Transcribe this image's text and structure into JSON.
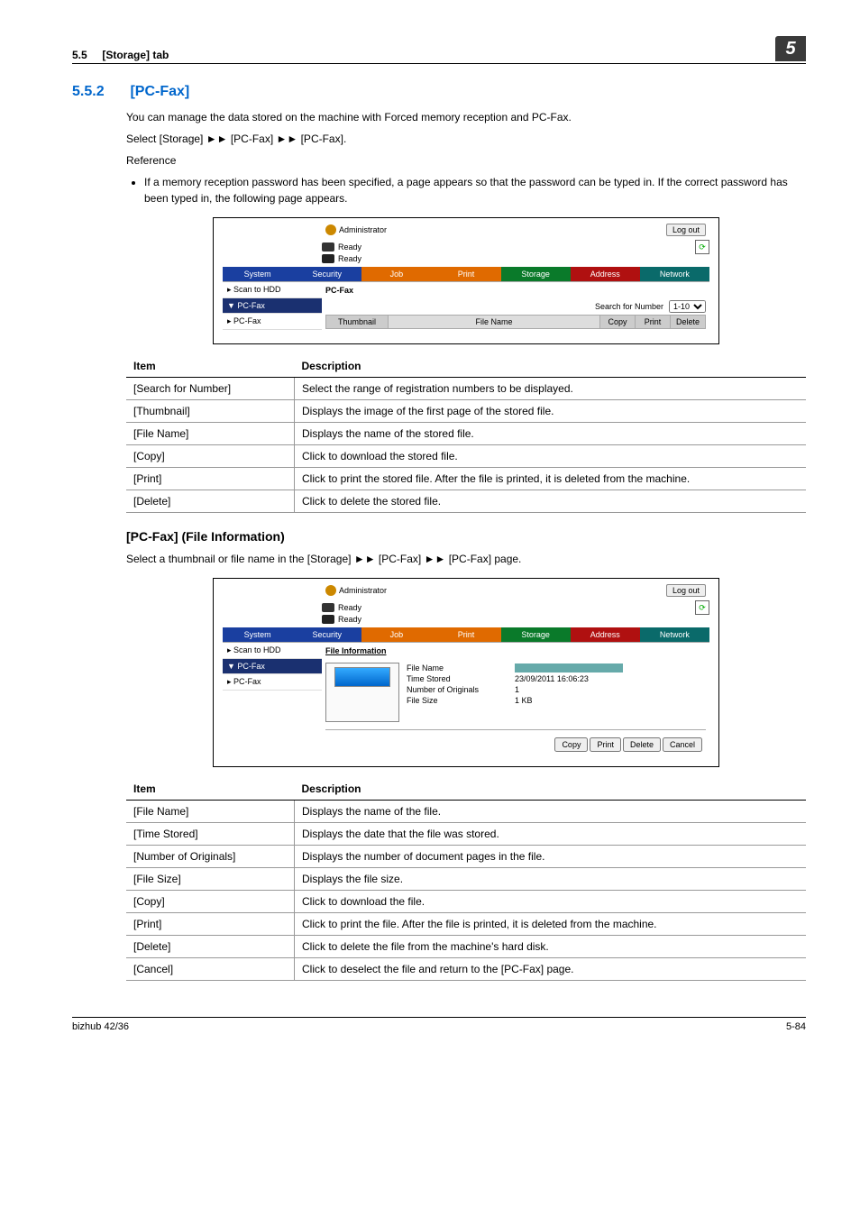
{
  "header": {
    "section": "5.5",
    "tab_label": "[Storage] tab",
    "chapter": "5"
  },
  "sec": {
    "num": "5.5.2",
    "title": "[PC-Fax]",
    "p1": "You can manage the data stored on the machine with Forced memory reception and PC-Fax.",
    "p2_a": "Select [Storage] ",
    "p2_arrow": "►►",
    "p2_b": " [PC-Fax] ",
    "p2_c": " [PC-Fax].",
    "ref_label": "Reference",
    "ref_b1": "If a memory reception password has been specified, a page appears so that the password can be typed in. If the correct password has been typed in, the following page appears."
  },
  "shot1": {
    "admin": "Administrator",
    "logout": "Log out",
    "ready": "Ready",
    "tabs": [
      "System",
      "Security",
      "Job",
      "Print",
      "Storage",
      "Address",
      "Network"
    ],
    "side": {
      "scan": "▸ Scan to HDD",
      "pcfax_h": "▼ PC-Fax",
      "pcfax": "▸ PC-Fax"
    },
    "main_title": "PC-Fax",
    "search_label": "Search for Number",
    "search_opt": "1-10",
    "cols": {
      "tn": "Thumbnail",
      "fn": "File Name",
      "c": "Copy",
      "p": "Print",
      "d": "Delete"
    }
  },
  "table1": {
    "h_item": "Item",
    "h_desc": "Description",
    "rows": [
      {
        "i": "[Search for Number]",
        "d": "Select the range of registration numbers to be displayed."
      },
      {
        "i": "[Thumbnail]",
        "d": "Displays the image of the first page of the stored file."
      },
      {
        "i": "[File Name]",
        "d": "Displays the name of the stored file."
      },
      {
        "i": "[Copy]",
        "d": "Click to download the stored file."
      },
      {
        "i": "[Print]",
        "d": "Click to print the stored file. After the file is printed, it is deleted from the machine."
      },
      {
        "i": "[Delete]",
        "d": "Click to delete the stored file."
      }
    ]
  },
  "sub2": {
    "title": "[PC-Fax] (File Information)",
    "p_a": "Select a thumbnail or file name in the [Storage] ",
    "arrow": "►►",
    "p_b": " [PC-Fax] ",
    "p_c": " [PC-Fax] page."
  },
  "shot2": {
    "admin": "Administrator",
    "logout": "Log out",
    "ready": "Ready",
    "tabs": [
      "System",
      "Security",
      "Job",
      "Print",
      "Storage",
      "Address",
      "Network"
    ],
    "side": {
      "scan": "▸ Scan to HDD",
      "pcfax_h": "▼ PC-Fax",
      "pcfax": "▸ PC-Fax"
    },
    "main_title": "File Information",
    "kv": {
      "fn_k": "File Name",
      "fn_v": "",
      "ts_k": "Time Stored",
      "ts_v": "23/09/2011 16:06:23",
      "no_k": "Number of Originals",
      "no_v": "1",
      "fs_k": "File Size",
      "fs_v": "1 KB"
    },
    "btns": {
      "copy": "Copy",
      "print": "Print",
      "delete": "Delete",
      "cancel": "Cancel"
    }
  },
  "table2": {
    "h_item": "Item",
    "h_desc": "Description",
    "rows": [
      {
        "i": "[File Name]",
        "d": "Displays the name of the file."
      },
      {
        "i": "[Time Stored]",
        "d": "Displays the date that the file was stored."
      },
      {
        "i": "[Number of Originals]",
        "d": "Displays the number of document pages in the file."
      },
      {
        "i": "[File Size]",
        "d": "Displays the file size."
      },
      {
        "i": "[Copy]",
        "d": "Click to download the file."
      },
      {
        "i": "[Print]",
        "d": "Click to print the file. After the file is printed, it is deleted from the machine."
      },
      {
        "i": "[Delete]",
        "d": "Click to delete the file from the machine's hard disk."
      },
      {
        "i": "[Cancel]",
        "d": "Click to deselect the file and return to the [PC-Fax] page."
      }
    ]
  },
  "footer": {
    "model": "bizhub 42/36",
    "page": "5-84"
  }
}
